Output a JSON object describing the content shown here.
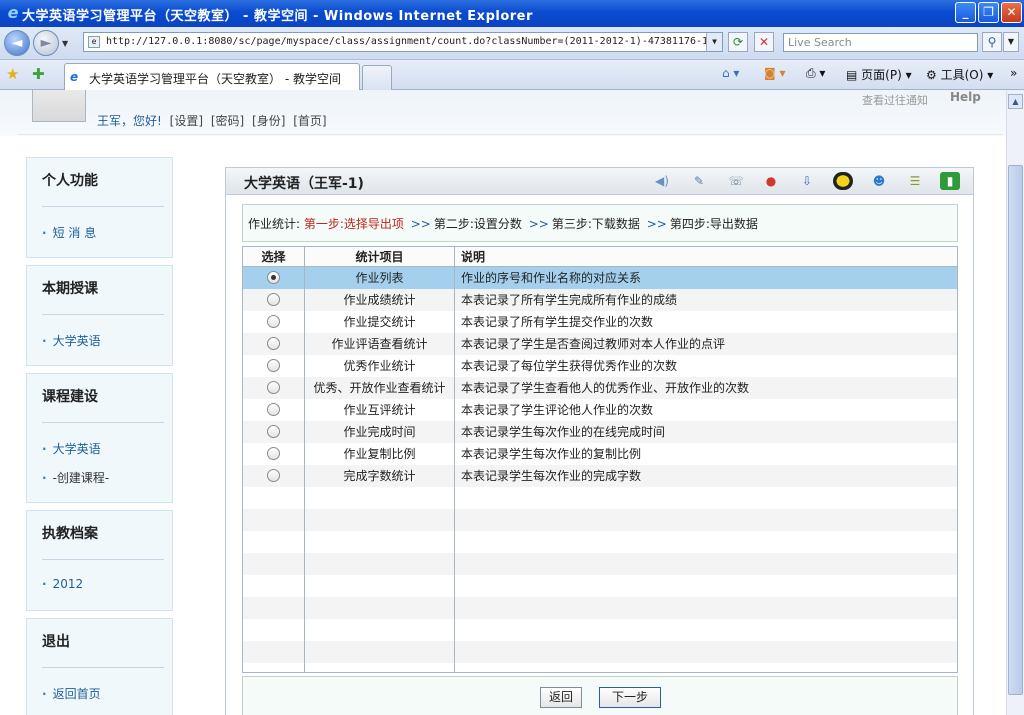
{
  "window": {
    "title": "大学英语学习管理平台（天空教室） - 教学空间 - Windows Internet Explorer"
  },
  "browser": {
    "url": "http://127.0.0.1:8080/sc/page/myspace/class/assignment/count.do?classNumber=(2011-2012-1)-47381176-1",
    "search_placeholder": "Live Search",
    "tab_title": "大学英语学习管理平台（天空教室） - 教学空间",
    "tools": {
      "page": "页面(P)",
      "tools": "工具(O)"
    }
  },
  "header": {
    "greeting": "王军，您好!",
    "links": [
      "[设置]",
      "[密码]",
      "[身份]",
      "[首页]"
    ],
    "notice": "查看过往通知",
    "help": "Help"
  },
  "sidebar": [
    {
      "title": "个人功能",
      "items": [
        "短 消 息"
      ]
    },
    {
      "title": "本期授课",
      "items": [
        "大学英语"
      ]
    },
    {
      "title": "课程建设",
      "items": [
        "大学英语",
        "-创建课程-"
      ]
    },
    {
      "title": "执教档案",
      "items": [
        "2012"
      ]
    },
    {
      "title": "退出",
      "items": [
        "返回首页"
      ]
    }
  ],
  "panel": {
    "title": "大学英语（王军-1)",
    "steps": {
      "prefix": "作业统计:",
      "step1": "第一步:选择导出项",
      "step2": "第二步:设置分数",
      "step3": "第三步:下载数据",
      "step4": "第四步:导出数据",
      "sep": ">>"
    },
    "table": {
      "headers": [
        "选择",
        "统计项目",
        "说明"
      ],
      "rows": [
        {
          "item": "作业列表",
          "desc": "作业的序号和作业名称的对应关系",
          "selected": true
        },
        {
          "item": "作业成绩统计",
          "desc": "本表记录了所有学生完成所有作业的成绩",
          "selected": false
        },
        {
          "item": "作业提交统计",
          "desc": "本表记录了所有学生提交作业的次数",
          "selected": false
        },
        {
          "item": "作业评语查看统计",
          "desc": "本表记录了学生是否查阅过教师对本人作业的点评",
          "selected": false
        },
        {
          "item": "优秀作业统计",
          "desc": "本表记录了每位学生获得优秀作业的次数",
          "selected": false
        },
        {
          "item": "优秀、开放作业查看统计",
          "desc": "本表记录了学生查看他人的优秀作业、开放作业的次数",
          "selected": false
        },
        {
          "item": "作业互评统计",
          "desc": "本表记录了学生评论他人作业的次数",
          "selected": false
        },
        {
          "item": "作业完成时间",
          "desc": "本表记录学生每次作业的在线完成时间",
          "selected": false
        },
        {
          "item": "作业复制比例",
          "desc": "本表记录学生每次作业的复制比例",
          "selected": false
        },
        {
          "item": "完成字数统计",
          "desc": "本表记录学生每次作业的完成字数",
          "selected": false
        }
      ]
    },
    "buttons": {
      "back": "返回",
      "next": "下一步"
    }
  }
}
